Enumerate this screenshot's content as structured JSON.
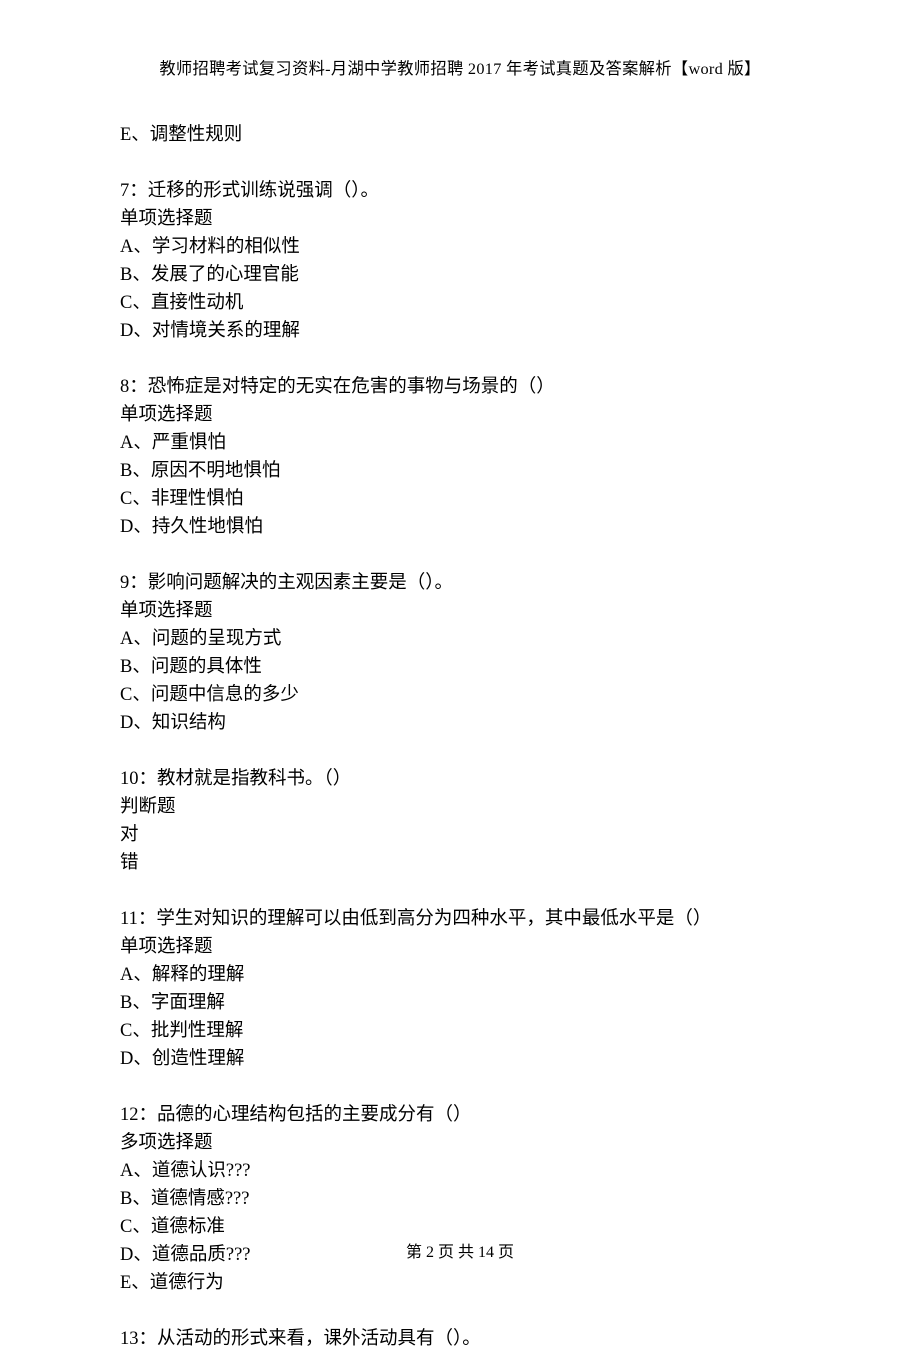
{
  "header": {
    "prefix": "教师招聘考试复习资料-月湖中学教师招聘 2017 年考试真题及答案解析【",
    "word": "word",
    "suffix": " 版】"
  },
  "blocks": [
    {
      "lines": [
        "E、调整性规则"
      ]
    },
    {
      "lines": [
        "7：迁移的形式训练说强调（）。",
        "单项选择题",
        "A、学习材料的相似性",
        "B、发展了的心理官能",
        "C、直接性动机",
        "D、对情境关系的理解"
      ]
    },
    {
      "lines": [
        "8：恐怖症是对特定的无实在危害的事物与场景的（）",
        "单项选择题",
        "A、严重惧怕",
        "B、原因不明地惧怕",
        "C、非理性惧怕",
        "D、持久性地惧怕"
      ]
    },
    {
      "lines": [
        "9：影响问题解决的主观因素主要是（）。",
        "单项选择题",
        "A、问题的呈现方式",
        "B、问题的具体性",
        "C、问题中信息的多少",
        "D、知识结构"
      ]
    },
    {
      "lines": [
        "10：教材就是指教科书。（）",
        "判断题",
        "对",
        "错"
      ]
    },
    {
      "lines": [
        "11：学生对知识的理解可以由低到高分为四种水平，其中最低水平是（）",
        "单项选择题",
        "A、解释的理解",
        "B、字面理解",
        "C、批判性理解",
        "D、创造性理解"
      ]
    },
    {
      "lines": [
        "12：品德的心理结构包括的主要成分有（）",
        "多项选择题",
        "A、道德认识???",
        "B、道德情感???",
        "C、道德标准",
        "D、道德品质???",
        "E、道德行为"
      ]
    },
    {
      "lines": [
        "13：从活动的形式来看，课外活动具有（）。"
      ]
    }
  ],
  "footer": "第 2 页 共 14 页"
}
